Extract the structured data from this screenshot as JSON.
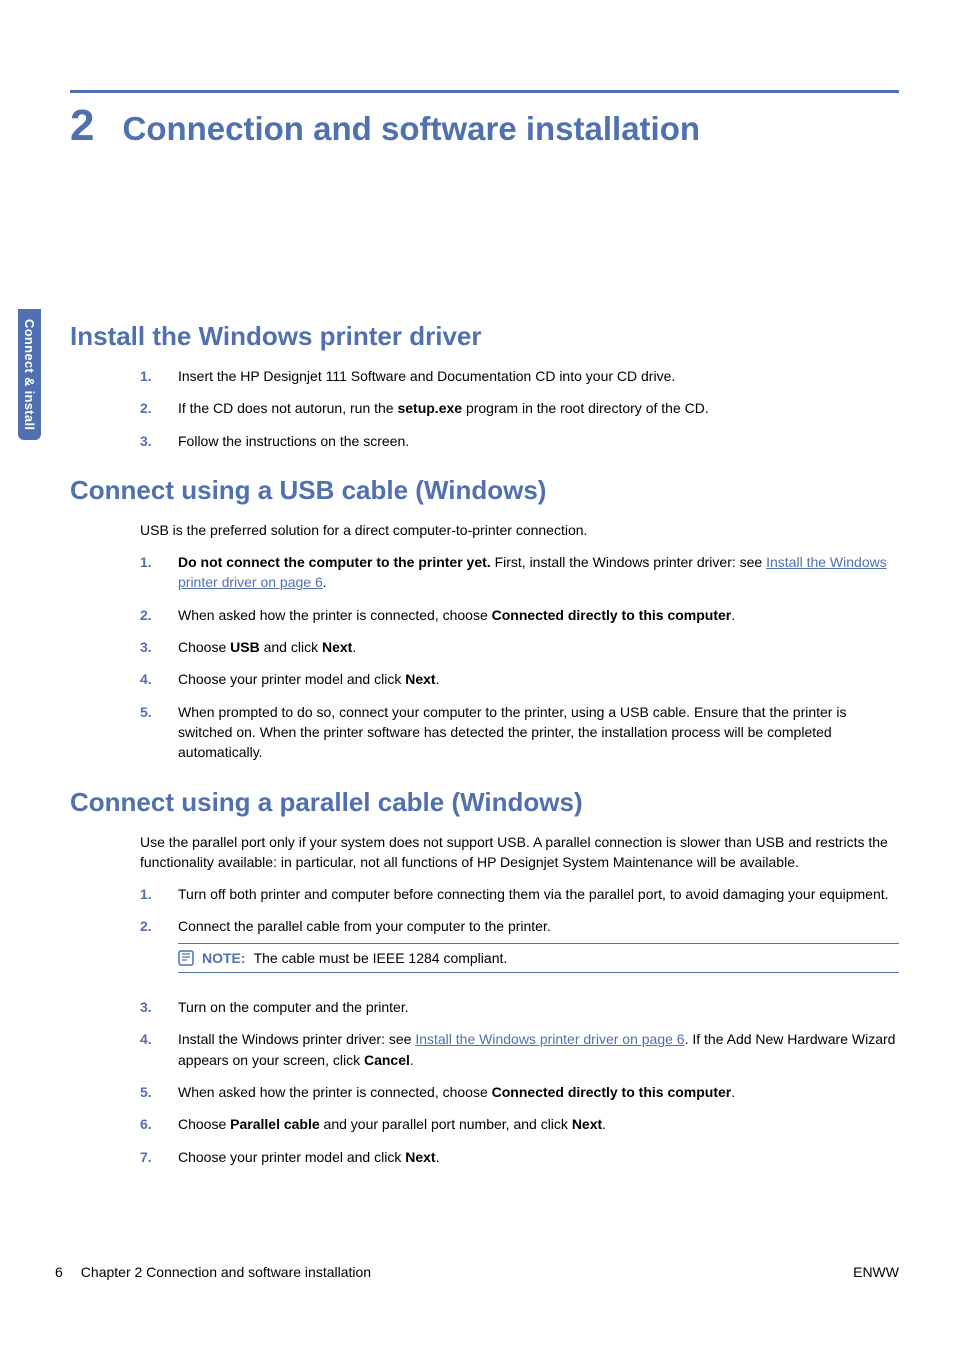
{
  "side_tab": "Connect & install",
  "chapter": {
    "num": "2",
    "title": "Connection and software installation"
  },
  "sec1": {
    "heading": "Install the Windows printer driver",
    "items": [
      {
        "n": "1.",
        "text": "Insert the HP Designjet 111 Software and Documentation CD into your CD drive."
      },
      {
        "n": "2.",
        "pre": "If the CD does not autorun, run the ",
        "bold": "setup.exe",
        "post": " program in the root directory of the CD."
      },
      {
        "n": "3.",
        "text": "Follow the instructions on the screen."
      }
    ]
  },
  "sec2": {
    "heading": "Connect using a USB cable (Windows)",
    "intro": "USB is the preferred solution for a direct computer-to-printer connection.",
    "items": {
      "i1": {
        "n": "1.",
        "bold": "Do not connect the computer to the printer yet.",
        "post": " First, install the Windows printer driver: see ",
        "link": "Install the Windows printer driver on page 6",
        "tail": "."
      },
      "i2": {
        "n": "2.",
        "pre": "When asked how the printer is connected, choose ",
        "bold": "Connected directly to this computer",
        "post": "."
      },
      "i3": {
        "n": "3.",
        "pre": "Choose ",
        "bold1": "USB",
        "mid": " and click ",
        "bold2": "Next",
        "post": "."
      },
      "i4": {
        "n": "4.",
        "pre": "Choose your printer model and click ",
        "bold": "Next",
        "post": "."
      },
      "i5": {
        "n": "5.",
        "text": "When prompted to do so, connect your computer to the printer, using a USB cable. Ensure that the printer is switched on. When the printer software has detected the printer, the installation process will be completed automatically."
      }
    }
  },
  "sec3": {
    "heading": "Connect using a parallel cable (Windows)",
    "intro": "Use the parallel port only if your system does not support USB. A parallel connection is slower than USB and restricts the functionality available: in particular, not all functions of HP Designjet System Maintenance will be available.",
    "items": {
      "i1": {
        "n": "1.",
        "text": "Turn off both printer and computer before connecting them via the parallel port, to avoid damaging your equipment."
      },
      "i2": {
        "n": "2.",
        "text": "Connect the parallel cable from your computer to the printer."
      },
      "note": {
        "label": "NOTE:",
        "text": "The cable must be IEEE 1284 compliant."
      },
      "i3": {
        "n": "3.",
        "text": "Turn on the computer and the printer."
      },
      "i4": {
        "n": "4.",
        "pre": "Install the Windows printer driver: see ",
        "link": "Install the Windows printer driver on page 6",
        "mid": ". If the Add New Hardware Wizard appears on your screen, click ",
        "bold": "Cancel",
        "post": "."
      },
      "i5": {
        "n": "5.",
        "pre": "When asked how the printer is connected, choose ",
        "bold": "Connected directly to this computer",
        "post": "."
      },
      "i6": {
        "n": "6.",
        "pre": "Choose ",
        "bold1": "Parallel cable",
        "mid": " and your parallel port number, and click ",
        "bold2": "Next",
        "post": "."
      },
      "i7": {
        "n": "7.",
        "pre": "Choose your printer model and click ",
        "bold": "Next",
        "post": "."
      }
    }
  },
  "footer": {
    "page": "6",
    "left": "Chapter 2   Connection and software installation",
    "right": "ENWW"
  }
}
